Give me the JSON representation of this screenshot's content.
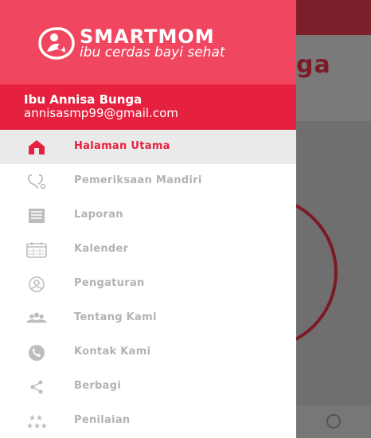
{
  "app": {
    "logo_name": "SMARTMOM",
    "logo_tagline": "ibu cerdas bayi sehat",
    "background_header_partial": "ga"
  },
  "user": {
    "name": "Ibu Annisa Bunga",
    "email": "annisasmp99@gmail.com"
  },
  "menu": [
    {
      "label": "Halaman Utama",
      "icon": "home-icon",
      "active": true
    },
    {
      "label": "Pemeriksaan Mandiri",
      "icon": "stethoscope-icon",
      "active": false
    },
    {
      "label": "Laporan",
      "icon": "report-icon",
      "active": false
    },
    {
      "label": "Kalender",
      "icon": "calendar-icon",
      "active": false
    },
    {
      "label": "Pengaturan",
      "icon": "user-settings-icon",
      "active": false
    },
    {
      "label": "Tentang Kami",
      "icon": "group-icon",
      "active": false
    },
    {
      "label": "Kontak Kami",
      "icon": "phone-icon",
      "active": false
    },
    {
      "label": "Berbagi",
      "icon": "share-icon",
      "active": false
    },
    {
      "label": "Penilaian",
      "icon": "stars-icon",
      "active": false
    }
  ],
  "colors": {
    "drawer_header": "#f0465f",
    "user_strip": "#e5213f",
    "active_text": "#e5213f",
    "inactive_text": "#b3b3b3"
  }
}
